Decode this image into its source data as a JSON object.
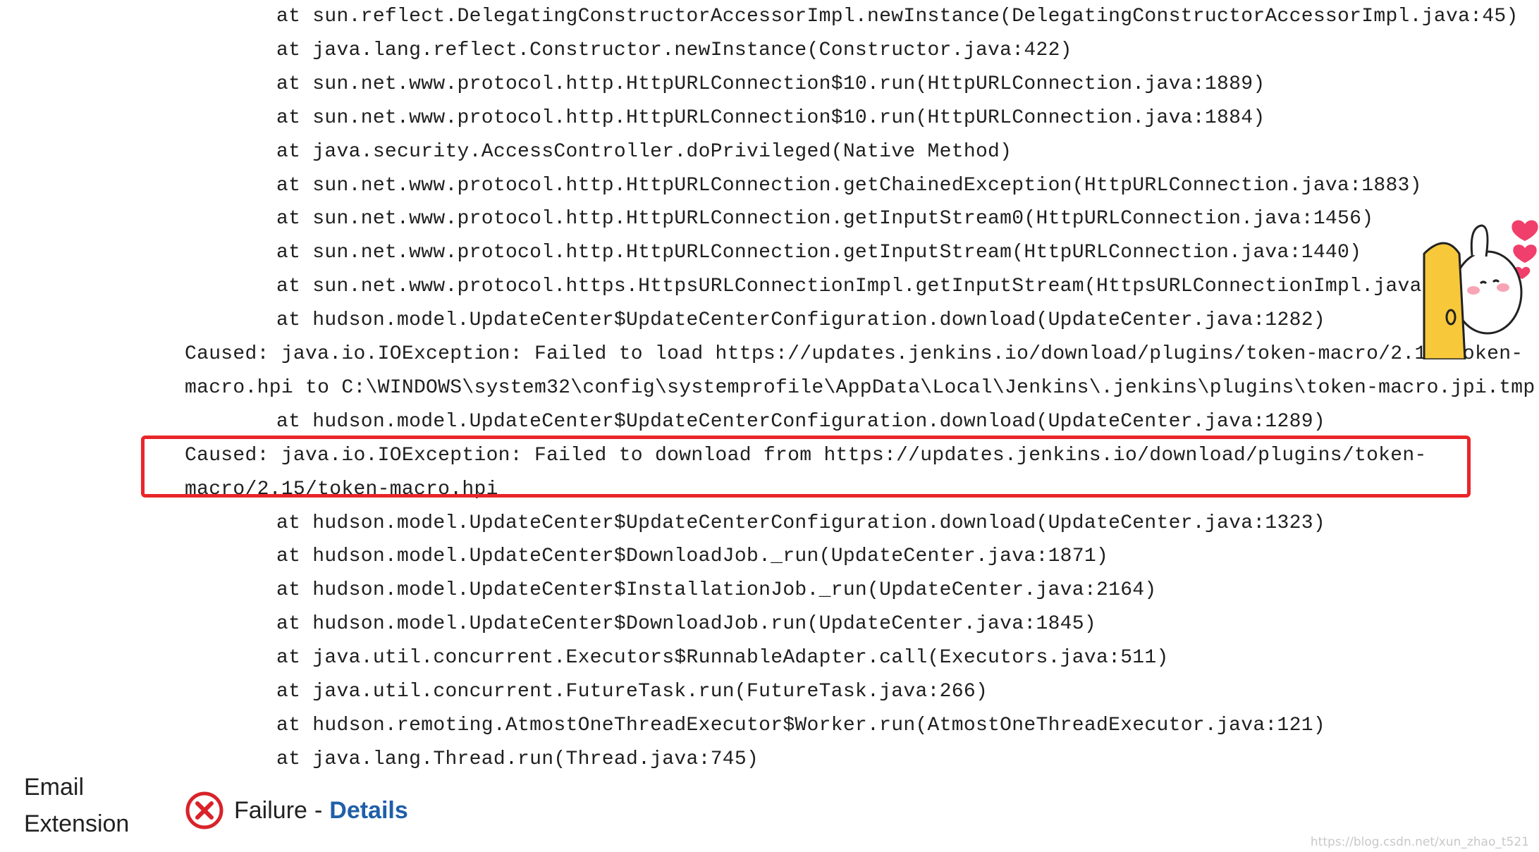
{
  "trace_lines": [
    {
      "kind": "at",
      "text": "at sun.reflect.DelegatingConstructorAccessorImpl.newInstance(DelegatingConstructorAccessorImpl.java:45)"
    },
    {
      "kind": "at",
      "text": "at java.lang.reflect.Constructor.newInstance(Constructor.java:422)"
    },
    {
      "kind": "at",
      "text": "at sun.net.www.protocol.http.HttpURLConnection$10.run(HttpURLConnection.java:1889)"
    },
    {
      "kind": "at",
      "text": "at sun.net.www.protocol.http.HttpURLConnection$10.run(HttpURLConnection.java:1884)"
    },
    {
      "kind": "at",
      "text": "at java.security.AccessController.doPrivileged(Native Method)"
    },
    {
      "kind": "at",
      "text": "at sun.net.www.protocol.http.HttpURLConnection.getChainedException(HttpURLConnection.java:1883)"
    },
    {
      "kind": "at",
      "text": "at sun.net.www.protocol.http.HttpURLConnection.getInputStream0(HttpURLConnection.java:1456)"
    },
    {
      "kind": "at",
      "text": "at sun.net.www.protocol.http.HttpURLConnection.getInputStream(HttpURLConnection.java:1440)"
    },
    {
      "kind": "at",
      "text": "at sun.net.www.protocol.https.HttpsURLConnectionImpl.getInputStream(HttpsURLConnectionImpl.java:2"
    },
    {
      "kind": "at",
      "text": "at hudson.model.UpdateCenter$UpdateCenterConfiguration.download(UpdateCenter.java:1282)"
    },
    {
      "kind": "caused",
      "text": "Caused: java.io.IOException: Failed to load https://updates.jenkins.io/download/plugins/token-macro/2.15/token-"
    },
    {
      "kind": "caused",
      "text": "macro.hpi to C:\\WINDOWS\\system32\\config\\systemprofile\\AppData\\Local\\Jenkins\\.jenkins\\plugins\\token-macro.jpi.tmp"
    },
    {
      "kind": "at",
      "text": "at hudson.model.UpdateCenter$UpdateCenterConfiguration.download(UpdateCenter.java:1289)"
    },
    {
      "kind": "caused",
      "text": "Caused: java.io.IOException: Failed to download from https://updates.jenkins.io/download/plugins/token-"
    },
    {
      "kind": "caused",
      "text": "macro/2.15/token-macro.hpi"
    },
    {
      "kind": "at",
      "text": "at hudson.model.UpdateCenter$UpdateCenterConfiguration.download(UpdateCenter.java:1323)"
    },
    {
      "kind": "at",
      "text": "at hudson.model.UpdateCenter$DownloadJob._run(UpdateCenter.java:1871)"
    },
    {
      "kind": "at",
      "text": "at hudson.model.UpdateCenter$InstallationJob._run(UpdateCenter.java:2164)"
    },
    {
      "kind": "at",
      "text": "at hudson.model.UpdateCenter$DownloadJob.run(UpdateCenter.java:1845)"
    },
    {
      "kind": "at",
      "text": "at java.util.concurrent.Executors$RunnableAdapter.call(Executors.java:511)"
    },
    {
      "kind": "at",
      "text": "at java.util.concurrent.FutureTask.run(FutureTask.java:266)"
    },
    {
      "kind": "at",
      "text": "at hudson.remoting.AtmostOneThreadExecutor$Worker.run(AtmostOneThreadExecutor.java:121)"
    },
    {
      "kind": "at",
      "text": "at java.lang.Thread.run(Thread.java:745)"
    }
  ],
  "plugin": {
    "name_line1": "Email",
    "name_line2": "Extension"
  },
  "status": {
    "icon": "error-circle-x-icon",
    "text": "Failure",
    "separator": "-",
    "details_label": "Details"
  },
  "colors": {
    "highlight_border": "#e8262a",
    "error_icon": "#d9222a",
    "link": "#1f5fa8"
  },
  "watermark": "https://blog.csdn.net/xun_zhao_t521"
}
